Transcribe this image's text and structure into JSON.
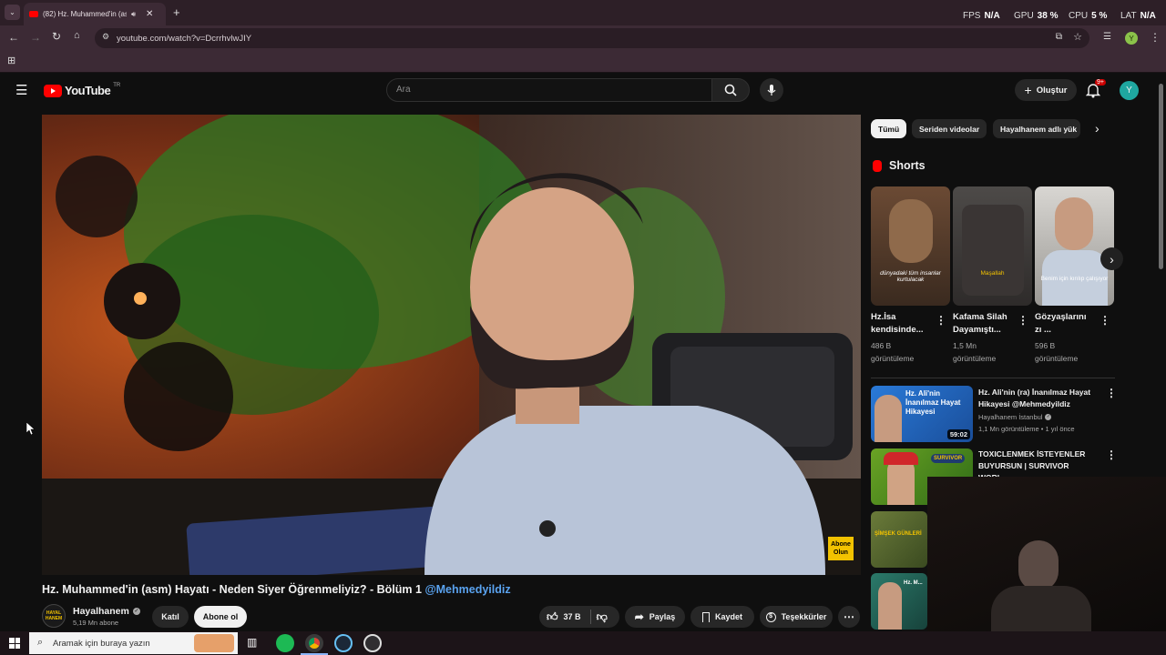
{
  "browser": {
    "tab_title": "(82) Hz. Muhammed'in (asm",
    "url": "youtube.com/watch?v=DcrrhvlwJIY",
    "profile_initial": "Y"
  },
  "overlay": {
    "fps_label": "FPS",
    "fps_value": "N/A",
    "gpu_label": "GPU",
    "gpu_value": "38 %",
    "cpu_label": "CPU",
    "cpu_value": "5 %",
    "lat_label": "LAT",
    "lat_value": "N/A"
  },
  "youtube": {
    "logo_text": "YouTube",
    "region": "TR",
    "search_placeholder": "Ara",
    "create_label": "Oluştur",
    "notif_count": "9+",
    "avatar_initial": "Y"
  },
  "video": {
    "title": "Hz. Muhammed'in (asm) Hayatı - Neden Siyer Öğrenmeliyiz? - Bölüm 1",
    "mention": "@Mehmedyildiz",
    "channel_name": "Hayalhanem",
    "subscribers": "5,19 Mn abone",
    "join_label": "Katıl",
    "subscribe_label": "Abone ol",
    "likes": "37 B",
    "share_label": "Paylaş",
    "save_label": "Kaydet",
    "thanks_label": "Teşekkürler",
    "watermark_line1": "Abone",
    "watermark_line2": "Olun",
    "channel_logo_text": "HAYAL HANEM"
  },
  "chips": [
    "Tümü",
    "Seriden videolar",
    "Hayalhanem adlı yük"
  ],
  "shorts_heading": "Shorts",
  "shorts": [
    {
      "title1": "Hz.İsa",
      "title2": "kendisinde...",
      "meta1": "486 B",
      "meta2": "görüntüleme",
      "caption": "dünyadaki tüm insanlar kurtulacak"
    },
    {
      "title1": "Kafama Silah",
      "title2": "Dayamıştı...",
      "meta1": "1,5 Mn",
      "meta2": "görüntüleme",
      "caption": "Maşallah"
    },
    {
      "title1": "Gözyaşlarını",
      "title2": "zı ...",
      "meta1": "596 B",
      "meta2": "görüntüleme",
      "caption": "Benim için kırılıp çalışıyor"
    }
  ],
  "recommendations": [
    {
      "title": "Hz. Ali'nin (ra) İnanılmaz Hayat Hikayesi @Mehmedyildiz",
      "channel": "Hayalhanem İstanbul",
      "meta": "1,1 Mn görüntüleme • 1 yıl önce",
      "duration": "59:02",
      "thumb_text": "Hz. Ali'nin İnanılmaz Hayat Hikayesi"
    },
    {
      "title": "TOXICLENMEK İSTEYENLER BUYURSUN | SURVIVOR WORL...",
      "thumb_text": "SURVIVOR"
    },
    {
      "thumb_text": "ŞİMŞEK GÜNLERİ"
    },
    {
      "thumb_text": "Hz. M..."
    }
  ],
  "taskbar": {
    "search_placeholder": "Aramak için buraya yazın"
  },
  "colors": {
    "youtube_red": "#ff0000",
    "mention_blue": "#5aa3f0",
    "avatar_teal": "#1fa7a0",
    "notif_red": "#cc0000"
  }
}
